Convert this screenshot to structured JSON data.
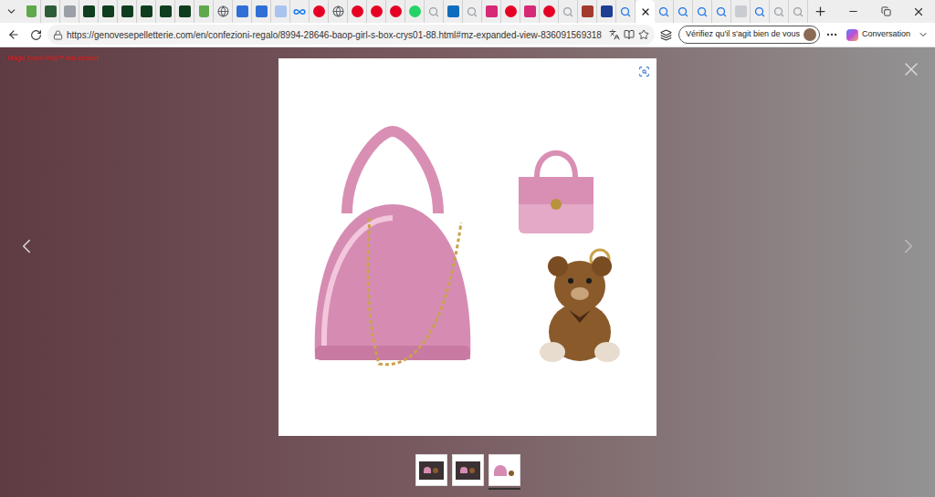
{
  "browser": {
    "tabs": [
      {
        "kind": "shop",
        "color": "#5fa84b",
        "selected": false
      },
      {
        "kind": "app",
        "color": "#2e5d3a",
        "selected": false
      },
      {
        "kind": "app",
        "color": "#9aa0a6",
        "selected": false
      },
      {
        "kind": "app",
        "color": "#0f3d1f",
        "selected": false
      },
      {
        "kind": "app",
        "color": "#0f3d1f",
        "selected": false
      },
      {
        "kind": "app",
        "color": "#0f3d1f",
        "selected": false
      },
      {
        "kind": "app",
        "color": "#0f3d1f",
        "selected": false
      },
      {
        "kind": "app",
        "color": "#0f3d1f",
        "selected": false
      },
      {
        "kind": "app",
        "color": "#0f3d1f",
        "selected": false
      },
      {
        "kind": "shop",
        "color": "#5fa84b",
        "selected": false
      },
      {
        "kind": "globe",
        "color": "#5f6368",
        "selected": false
      },
      {
        "kind": "doc",
        "color": "#2f6fd6",
        "selected": false
      },
      {
        "kind": "doc",
        "color": "#2f6fd6",
        "selected": false
      },
      {
        "kind": "doc",
        "color": "#a9c4ee",
        "selected": false
      },
      {
        "kind": "meta",
        "color": "#1877f2",
        "selected": false
      },
      {
        "kind": "round",
        "color": "#e60023",
        "selected": false
      },
      {
        "kind": "globe",
        "color": "#5f6368",
        "selected": false
      },
      {
        "kind": "round",
        "color": "#e60023",
        "selected": false
      },
      {
        "kind": "round",
        "color": "#e60023",
        "selected": false
      },
      {
        "kind": "round",
        "color": "#e60023",
        "selected": false
      },
      {
        "kind": "round",
        "color": "#25d366",
        "selected": false
      },
      {
        "kind": "search",
        "color": "#9aa0a6",
        "selected": false
      },
      {
        "kind": "doc",
        "color": "#0f6cbd",
        "selected": false
      },
      {
        "kind": "search",
        "color": "#9aa0a6",
        "selected": false
      },
      {
        "kind": "doc",
        "color": "#d62976",
        "selected": false
      },
      {
        "kind": "round",
        "color": "#e60023",
        "selected": false
      },
      {
        "kind": "doc",
        "color": "#d62976",
        "selected": false
      },
      {
        "kind": "round",
        "color": "#e60023",
        "selected": false
      },
      {
        "kind": "search",
        "color": "#9aa0a6",
        "selected": false
      },
      {
        "kind": "doc",
        "color": "#a33a2e",
        "selected": false
      },
      {
        "kind": "doc",
        "color": "#1c3f94",
        "selected": false
      },
      {
        "kind": "search",
        "color": "#1a73e8",
        "selected": false
      },
      {
        "kind": "search",
        "color": "#1a73e8",
        "selected": true
      },
      {
        "kind": "search",
        "color": "#1a73e8",
        "selected": false
      },
      {
        "kind": "search",
        "color": "#1a73e8",
        "selected": false
      },
      {
        "kind": "search",
        "color": "#1a73e8",
        "selected": false
      },
      {
        "kind": "search",
        "color": "#1a73e8",
        "selected": false
      },
      {
        "kind": "doc",
        "color": "#c9ccd1",
        "selected": false
      },
      {
        "kind": "search",
        "color": "#1a73e8",
        "selected": false
      },
      {
        "kind": "search",
        "color": "#9aa0a6",
        "selected": false
      },
      {
        "kind": "search",
        "color": "#9aa0a6",
        "selected": false
      }
    ]
  },
  "address_bar": {
    "url": "https://genovesepelletterie.com/en/confezioni-regalo/8994-28646-baop-girl-s-box-crys01-88.html#mz-expanded-view-836091569318",
    "profile_button": "Vérifiez qu'il s'agit bien de vous",
    "copilot_button": "Conversation"
  },
  "viewer": {
    "watermark": "Magic Zoom Plus™ trial version",
    "thumbnails": [
      {
        "kind": "box",
        "selected": false
      },
      {
        "kind": "box",
        "selected": false
      },
      {
        "kind": "set",
        "selected": true
      }
    ]
  }
}
